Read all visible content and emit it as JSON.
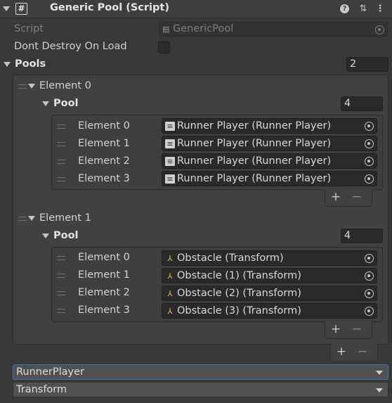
{
  "header": {
    "badge": "#",
    "title": "Generic Pool (Script)",
    "help_icon": "?",
    "presets_icon": "⇅",
    "menu_icon": "⋮"
  },
  "script_row": {
    "label": "Script",
    "value": "GenericPool"
  },
  "dont_destroy": {
    "label": "Dont Destroy On Load",
    "checked": false
  },
  "pools": {
    "label": "Pools",
    "size": "2",
    "elements": [
      {
        "label": "Element 0",
        "pool_label": "Pool",
        "pool_size": "4",
        "items": [
          {
            "label": "Element 0",
            "value": "Runner Player (Runner Player)"
          },
          {
            "label": "Element 1",
            "value": "Runner Player (Runner Player)"
          },
          {
            "label": "Element 2",
            "value": "Runner Player (Runner Player)"
          },
          {
            "label": "Element 3",
            "value": "Runner Player (Runner Player)"
          }
        ]
      },
      {
        "label": "Element 1",
        "pool_label": "Pool",
        "pool_size": "4",
        "items": [
          {
            "label": "Element 0",
            "value": "Obstacle (Transform)"
          },
          {
            "label": "Element 1",
            "value": "Obstacle (1) (Transform)"
          },
          {
            "label": "Element 2",
            "value": "Obstacle (2) (Transform)"
          },
          {
            "label": "Element 3",
            "value": "Obstacle (3) (Transform)"
          }
        ]
      }
    ]
  },
  "list_buttons": {
    "add": "+",
    "remove": "−"
  },
  "dropdowns": [
    {
      "value": "RunnerPlayer"
    },
    {
      "value": "Transform"
    }
  ]
}
